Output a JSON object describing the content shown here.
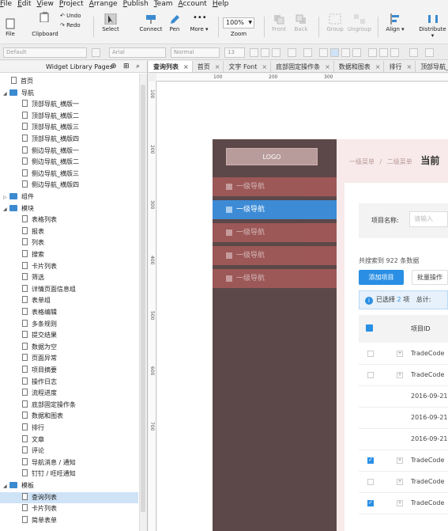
{
  "menubar": [
    "File",
    "Edit",
    "View",
    "Project",
    "Arrange",
    "Publish",
    "Team",
    "Account",
    "Help"
  ],
  "toolbar": {
    "file": "File",
    "clipboard": "Clipboard",
    "undo": "Undo",
    "redo": "Redo",
    "select": "Select",
    "connect": "Connect",
    "pen": "Pen",
    "more": "More ▾",
    "zoom_value": "100%",
    "zoom_label": "Zoom",
    "front": "Front",
    "back": "Back",
    "group": "Group",
    "ungroup": "Ungroup",
    "align": "Align ▾",
    "distribute": "Distribute ▾"
  },
  "formatbar": {
    "style": "Default",
    "font": "Arial",
    "weight": "Normal",
    "size": "13"
  },
  "left_panel": {
    "title": "Widget Library Pages",
    "rows": [
      {
        "label": "首页",
        "kind": "page",
        "indent": 1
      },
      {
        "label": "导航",
        "kind": "folder",
        "indent": 0,
        "open": true
      },
      {
        "label": "顶部导航_横版一",
        "kind": "page",
        "indent": 2
      },
      {
        "label": "顶部导航_横版二",
        "kind": "page",
        "indent": 2
      },
      {
        "label": "顶部导航_横版三",
        "kind": "page",
        "indent": 2
      },
      {
        "label": "顶部导航_横版四",
        "kind": "page",
        "indent": 2
      },
      {
        "label": "侧边导航_横版一",
        "kind": "page",
        "indent": 2
      },
      {
        "label": "侧边导航_横版二",
        "kind": "page",
        "indent": 2
      },
      {
        "label": "侧边导航_横版三",
        "kind": "page",
        "indent": 2
      },
      {
        "label": "侧边导航_横版四",
        "kind": "page",
        "indent": 2
      },
      {
        "label": "组件",
        "kind": "folder",
        "indent": 0,
        "open": false
      },
      {
        "label": "模块",
        "kind": "folder",
        "indent": 0,
        "open": true
      },
      {
        "label": "表格列表",
        "kind": "page",
        "indent": 2
      },
      {
        "label": "报表",
        "kind": "page",
        "indent": 2
      },
      {
        "label": "列表",
        "kind": "page",
        "indent": 2
      },
      {
        "label": "搜索",
        "kind": "page",
        "indent": 2
      },
      {
        "label": "卡片列表",
        "kind": "page",
        "indent": 2
      },
      {
        "label": "筛选",
        "kind": "page",
        "indent": 2
      },
      {
        "label": "详情页面信息组",
        "kind": "page",
        "indent": 2
      },
      {
        "label": "表单组",
        "kind": "page",
        "indent": 2
      },
      {
        "label": "表格编辑",
        "kind": "page",
        "indent": 2
      },
      {
        "label": "多条规则",
        "kind": "page",
        "indent": 2
      },
      {
        "label": "提交结果",
        "kind": "page",
        "indent": 2
      },
      {
        "label": "数据为空",
        "kind": "page",
        "indent": 2
      },
      {
        "label": "页面异常",
        "kind": "page",
        "indent": 2
      },
      {
        "label": "项目摘要",
        "kind": "page",
        "indent": 2
      },
      {
        "label": "操作日志",
        "kind": "page",
        "indent": 2
      },
      {
        "label": "流程进度",
        "kind": "page",
        "indent": 2
      },
      {
        "label": "底部固定操作条",
        "kind": "page",
        "indent": 2
      },
      {
        "label": "数据和图表",
        "kind": "page",
        "indent": 2
      },
      {
        "label": "排行",
        "kind": "page",
        "indent": 2
      },
      {
        "label": "文章",
        "kind": "page",
        "indent": 2
      },
      {
        "label": "评论",
        "kind": "page",
        "indent": 2
      },
      {
        "label": "导航消息 / 通知",
        "kind": "page",
        "indent": 2
      },
      {
        "label": "钉钉 / 旺旺通知",
        "kind": "page",
        "indent": 2
      },
      {
        "label": "模板",
        "kind": "folder",
        "indent": 0,
        "open": true
      },
      {
        "label": "查询列表",
        "kind": "page",
        "indent": 2,
        "selected": true
      },
      {
        "label": "卡片列表",
        "kind": "page",
        "indent": 2
      },
      {
        "label": "简单表单",
        "kind": "page",
        "indent": 2
      }
    ]
  },
  "tabs": [
    {
      "label": "查询列表",
      "active": true
    },
    {
      "label": "首页"
    },
    {
      "label": "文字 Font"
    },
    {
      "label": "底部固定操作条"
    },
    {
      "label": "数据和图表"
    },
    {
      "label": "排行"
    },
    {
      "label": "顶部导航_横版"
    }
  ],
  "ruler_top": [
    "100",
    "200",
    "300"
  ],
  "ruler_left": [
    "100",
    "200",
    "300",
    "400",
    "500",
    "600",
    "700"
  ],
  "proto": {
    "logo": "LOGO",
    "nav": [
      {
        "label": "一级导航",
        "active": false
      },
      {
        "label": "一级导航",
        "active": true
      },
      {
        "label": "一级导航",
        "active": false
      },
      {
        "label": "一级导航",
        "active": false
      },
      {
        "label": "一级导航",
        "active": false
      }
    ],
    "breadcrumb": {
      "a": "一级菜单",
      "sep": "/",
      "b": "二级菜单",
      "current": "当前"
    },
    "filter_label": "项目名称:",
    "filter_placeholder": "请输入",
    "count_text": "共搜索到 922 条数据",
    "add_button": "添加项目",
    "batch_button": "批量操作",
    "sel_prefix": "已选择",
    "sel_count": "2",
    "sel_suffix": "项",
    "sel_total": "总计: ",
    "col_header": "项目ID",
    "rows": [
      {
        "value": "TradeCode",
        "checked": false,
        "expand": true
      },
      {
        "value": "TradeCode",
        "checked": false,
        "expand": true
      },
      {
        "value": "2016-09-21",
        "checked": false,
        "expand": false,
        "nocb": true
      },
      {
        "value": "2016-09-21",
        "checked": false,
        "expand": false,
        "nocb": true
      },
      {
        "value": "2016-09-21",
        "checked": false,
        "expand": false,
        "nocb": true
      },
      {
        "value": "TradeCode",
        "checked": true,
        "expand": true
      },
      {
        "value": "TradeCode",
        "checked": false,
        "expand": true
      },
      {
        "value": "TradeCode",
        "checked": true,
        "expand": true
      }
    ]
  }
}
